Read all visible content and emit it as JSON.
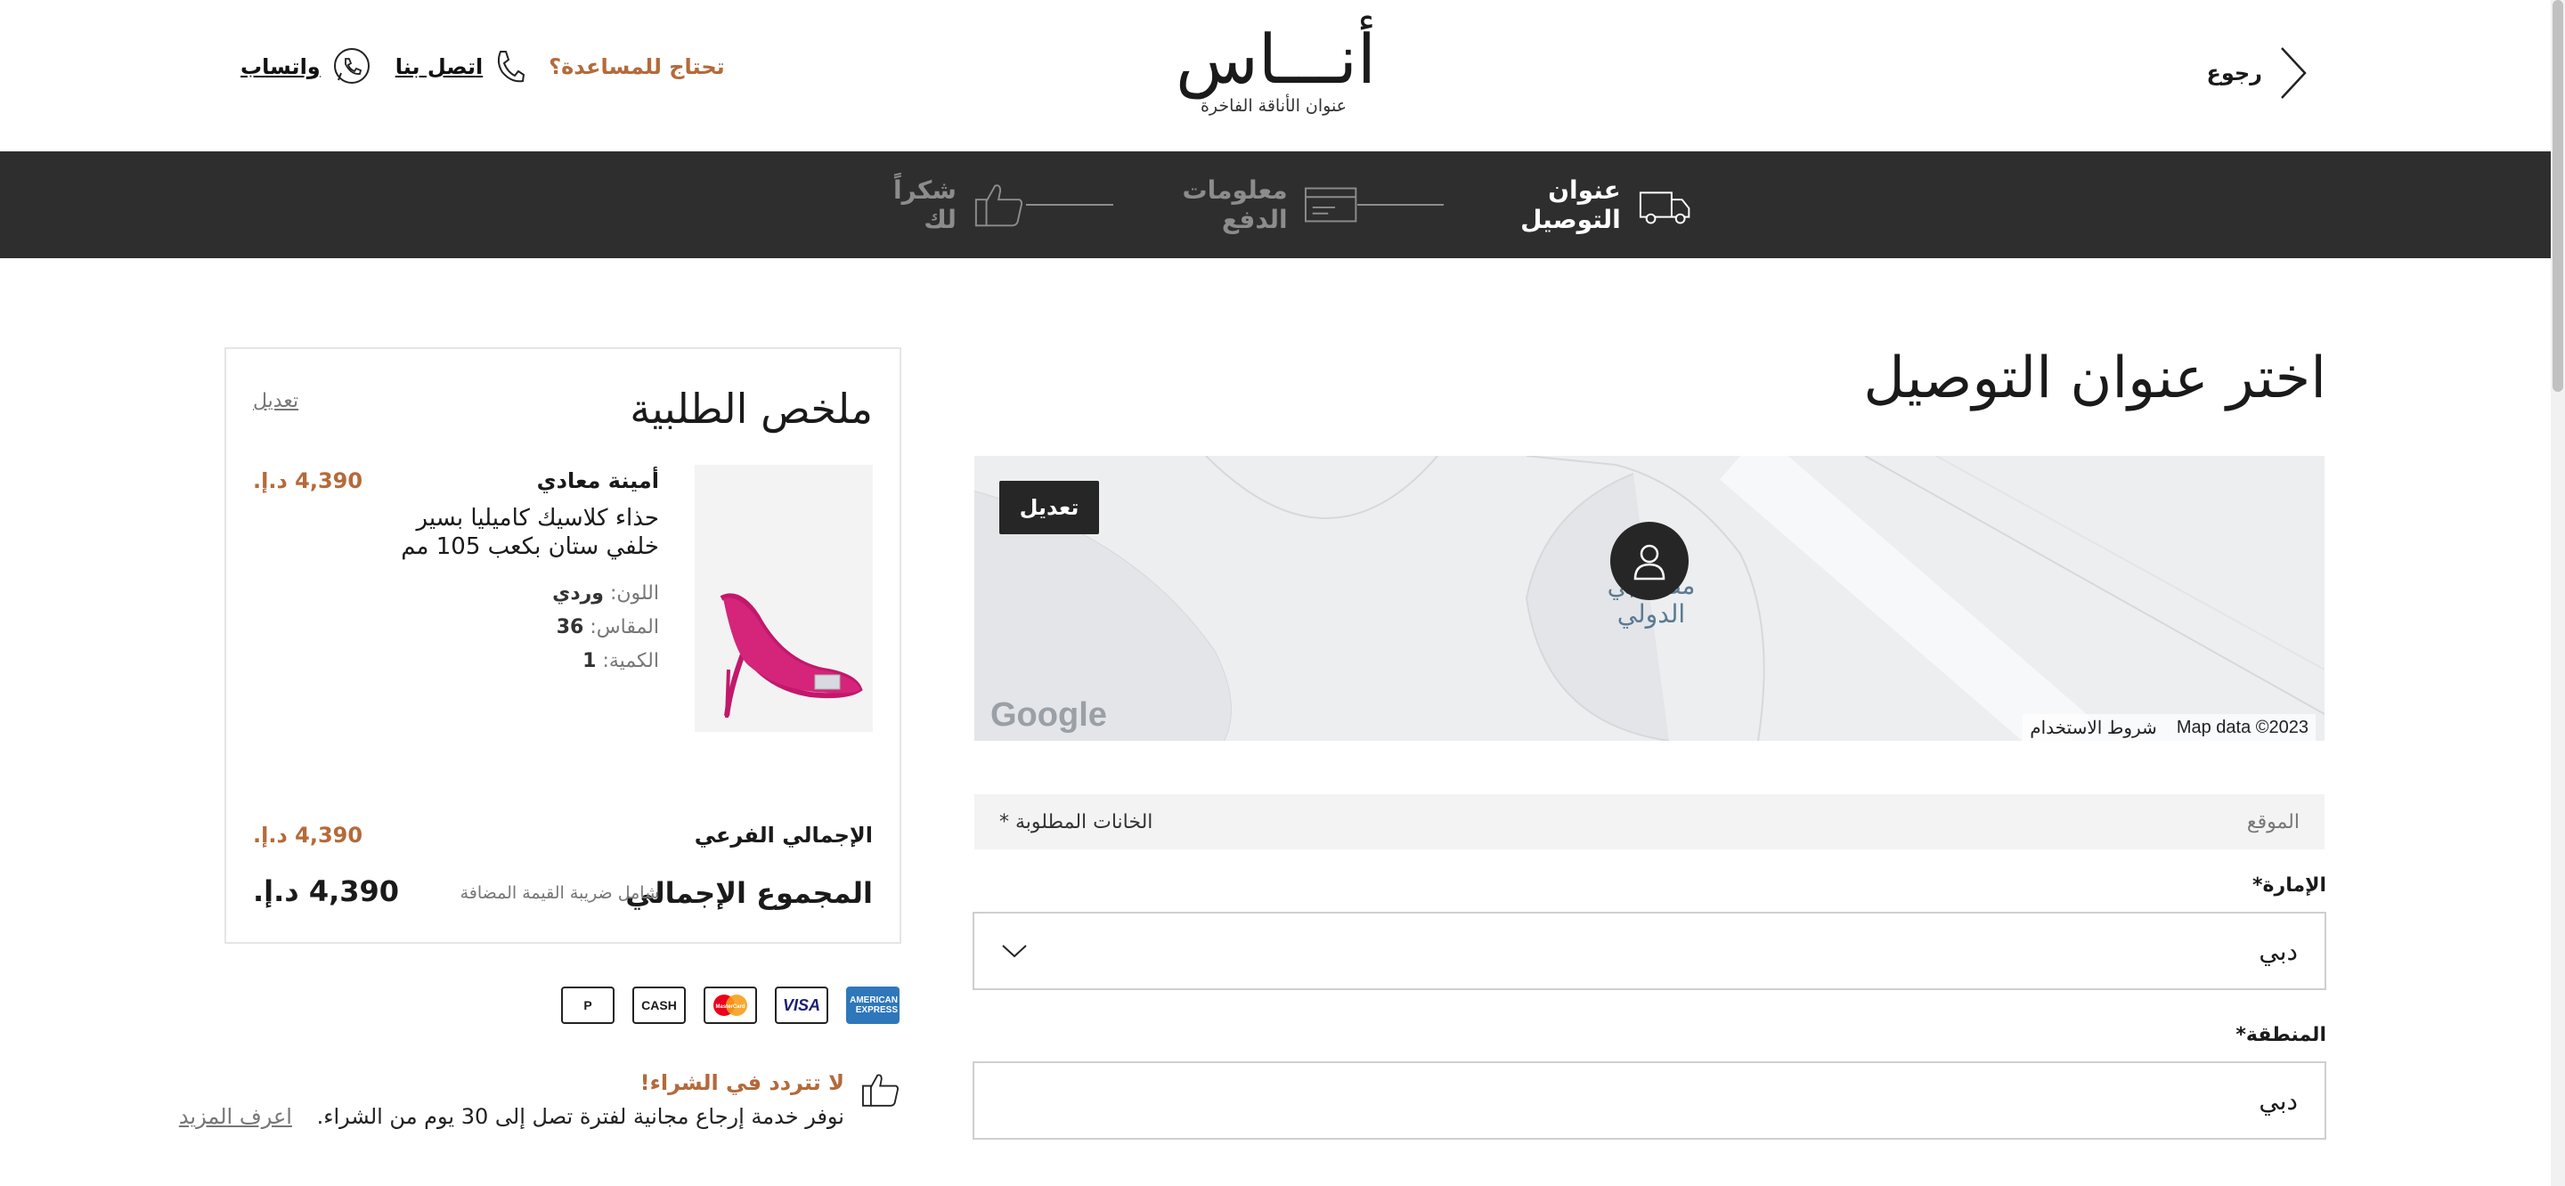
{
  "header": {
    "back_label": "رجوع",
    "logo_text": "أنـــاس",
    "logo_tagline": "عنوان الأناقة الفاخرة",
    "help_question": "تحتاج للمساعدة؟",
    "call_label": "اتصل بنا",
    "whatsapp_label": "واتساب"
  },
  "steps": [
    {
      "label": "عنوان التوصيل",
      "icon": "delivery-van-icon",
      "active": true
    },
    {
      "label": "معلومات الدفع",
      "icon": "card-icon",
      "active": false
    },
    {
      "label": "شكراً لك",
      "icon": "thumbs-up-icon",
      "active": false
    }
  ],
  "delivery": {
    "title": "اختر عنوان التوصيل",
    "map": {
      "edit_label": "تعديل",
      "place_label": "مطـ دبي الدولي",
      "google_label": "Google",
      "map_data": "Map data ©2023",
      "terms": "شروط الاستخدام"
    },
    "location_label": "الموقع",
    "required_note": "الخانات المطلوبة *",
    "emirate": {
      "label": "الإمارة*",
      "value": "دبي"
    },
    "area": {
      "label": "المنطقة*",
      "value": "دبي"
    }
  },
  "summary": {
    "title": "ملخص الطلبية",
    "edit_label": "تعديل",
    "product": {
      "brand": "أمينة معادي",
      "name": "حذاء كلاسيك كاميليا بسير خلفي ستان بكعب 105 مم",
      "price": "4,390 د.إ.",
      "color_label": "اللون:",
      "color_value": "وردي",
      "size_label": "المقاس:",
      "size_value": "36",
      "qty_label": "الكمية:",
      "qty_value": "1"
    },
    "subtotal_label": "الإجمالي الفرعي",
    "subtotal_value": "4,390 د.إ.",
    "total_label": "المجموع الإجمالي",
    "vat_note": "شامل ضريبة القيمة المضافة",
    "total_value": "4,390 د.إ."
  },
  "payments": [
    "AMERICAN EXPRESS",
    "VISA",
    "MasterCard",
    "CASH",
    "P"
  ],
  "returns": {
    "title": "لا تتردد في الشراء!",
    "text": "نوفر خدمة إرجاع مجانية لفترة تصل إلى 30 يوم من الشراء.",
    "more": "اعرف المزيد"
  },
  "colors": {
    "accent": "#b46a3a",
    "dark": "#2e2e2e"
  }
}
